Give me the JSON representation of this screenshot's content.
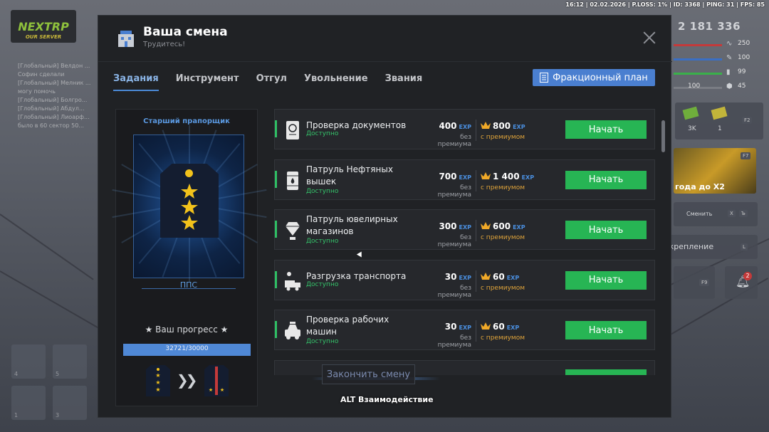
{
  "hud": {
    "top_info": "16:12 | 02.02.2026 | P.LOSS: 1% | ID: 3368 | PING: 31 | FPS: 85",
    "logo_main": "NEXTRP",
    "logo_sub": "OUR SERVER",
    "money": "2 181 336",
    "stats": [
      {
        "icon": "pulse-icon",
        "value": "250",
        "color": "#c43a3a"
      },
      {
        "icon": "pin-icon",
        "value": "100",
        "color": "#3a6fc4"
      },
      {
        "icon": "chart-icon",
        "value": "99",
        "color": "#3ab04a"
      },
      {
        "icon": "armor-icon",
        "value": "45",
        "color": "#7a7d84"
      }
    ],
    "stat_extra": "100",
    "right_tiles": {
      "cash_a": "3K",
      "cash_b": "1",
      "f2": "F2",
      "f7": "F7",
      "banner": "года до Х2",
      "change_label": "Сменить",
      "change_keys": [
        "X",
        "Ъ"
      ],
      "reinforce_label": "дкрепление",
      "reinforce_key": "L",
      "f9": "F9",
      "notif_count": "2"
    },
    "chat_lines": [
      "[Глобальный] Велдон ...",
      "Софин сделали",
      "[Глобальный] Мелник ...",
      "могу помочь",
      "[Глобальный] Болгро...",
      "[Глобальный] Абдул...",
      "[Глобальный] Лиоарф...",
      "было в 60 сектор 50..."
    ],
    "slots": [
      "4",
      "5",
      "1",
      "3"
    ]
  },
  "window": {
    "title": "Ваша смена",
    "subtitle": "Трудитесь!",
    "tabs": [
      "Задания",
      "Инструмент",
      "Отгул",
      "Увольнение",
      "Звания"
    ],
    "active_tab": 0,
    "plan_button": "Фракционный план"
  },
  "rank": {
    "title": "Старший прапорщик",
    "unit": "ППС",
    "progress_label": "★ Ваш прогресс ★",
    "progress_text": "32721/30000",
    "progress_fraction": 1.0
  },
  "task_labels": {
    "base": "без премиума",
    "premium": "с премиумом",
    "exp": "EXP",
    "start": "Начать",
    "available": "Доступно"
  },
  "tasks": [
    {
      "name": "Проверка документов",
      "icon": "passport-icon",
      "base": "400",
      "premium": "800",
      "two_line": false
    },
    {
      "name": "Патруль Нефтяных вышек",
      "icon": "oil-barrel-icon",
      "base": "700",
      "premium": "1 400",
      "two_line": true
    },
    {
      "name": "Патруль ювелирных магазинов",
      "icon": "diamond-icon",
      "base": "300",
      "premium": "600",
      "two_line": true
    },
    {
      "name": "Разгрузка транспорта",
      "icon": "truck-loader-icon",
      "base": "30",
      "premium": "60",
      "two_line": false
    },
    {
      "name": "Проверка рабочих машин",
      "icon": "car-icon",
      "base": "30",
      "premium": "60",
      "two_line": true
    }
  ],
  "footer": {
    "end_shift": "Закончить смену",
    "alt_hint": "ALT Взаимодействие"
  }
}
